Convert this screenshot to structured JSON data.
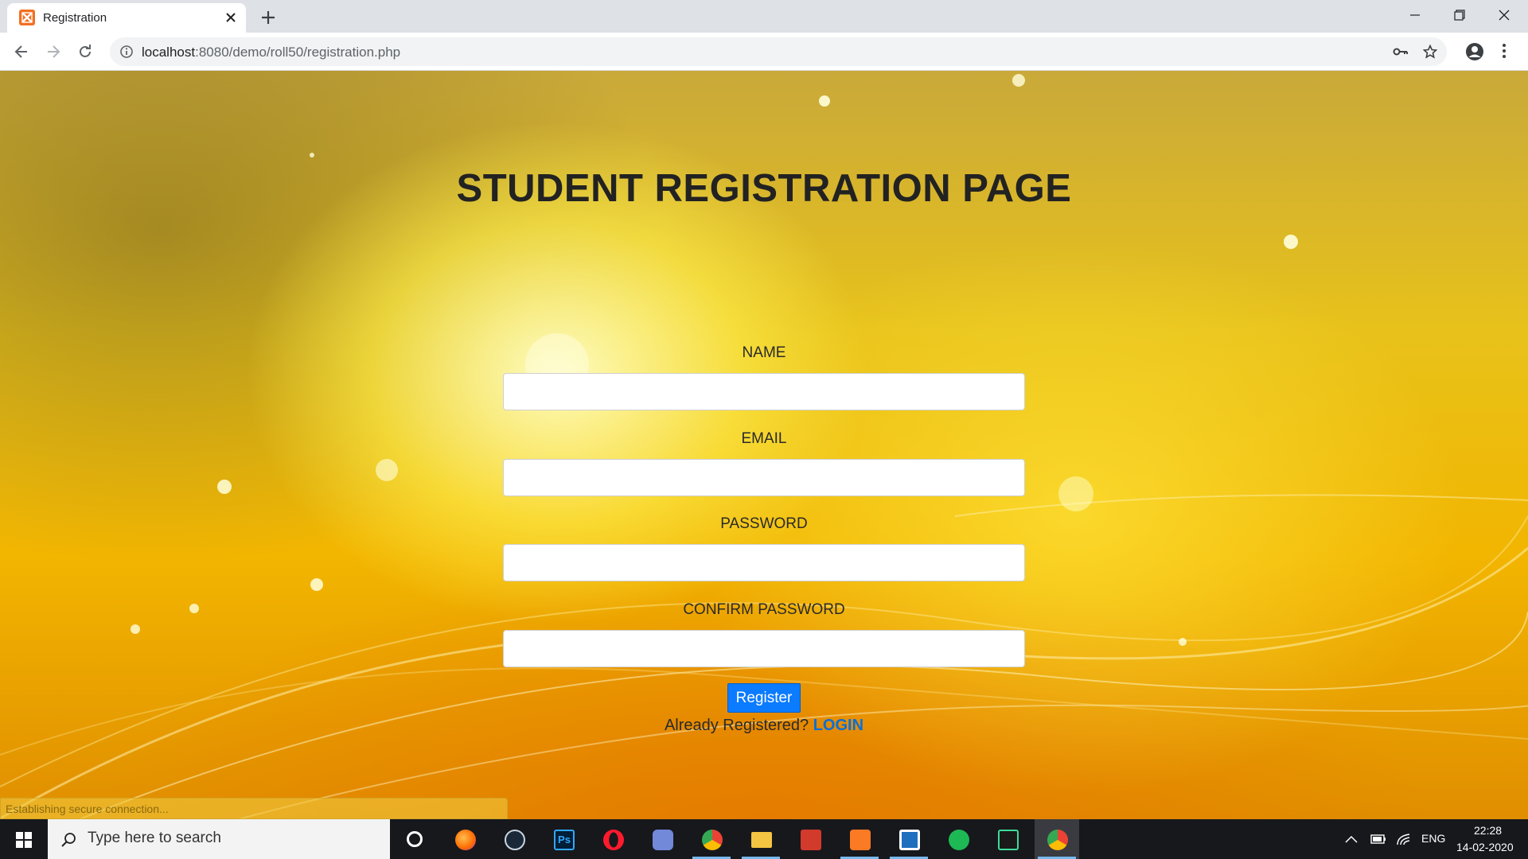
{
  "browser": {
    "tab_title": "Registration",
    "url_host": "localhost",
    "url_rest": ":8080/demo/roll50/registration.php",
    "icons": [
      "xampp-favicon",
      "close-icon",
      "plus-icon",
      "minimize-icon",
      "restore-icon",
      "window-close-icon",
      "back-icon",
      "forward-icon",
      "reload-icon",
      "info-icon",
      "key-icon",
      "star-icon",
      "account-icon",
      "menu-icon"
    ]
  },
  "page": {
    "title": "STUDENT REGISTRATION PAGE",
    "fields": {
      "name_label": "NAME",
      "email_label": "EMAIL",
      "password_label": "PASSWORD",
      "confirm_label": "CONFIRM PASSWORD",
      "name_value": "",
      "email_value": "",
      "password_value": "",
      "confirm_value": ""
    },
    "register_label": "Register",
    "already_text": "Already Registered?",
    "login_label": "LOGIN",
    "status_text": "Establishing secure connection..."
  },
  "taskbar": {
    "search_placeholder": "Type here to search",
    "apps": [
      "cortana",
      "firefox",
      "steam",
      "photoshop",
      "opera",
      "discord",
      "chrome",
      "file-explorer",
      "media-player",
      "xampp",
      "notepad-plus",
      "spotify",
      "xbox-bar",
      "chrome-active"
    ],
    "language": "ENG",
    "time": "22:28",
    "date": "14-02-2020"
  },
  "colors": {
    "accent_button": "#0b7bff",
    "login_link": "#0b6fd6",
    "background_gold": "#f2b500"
  }
}
